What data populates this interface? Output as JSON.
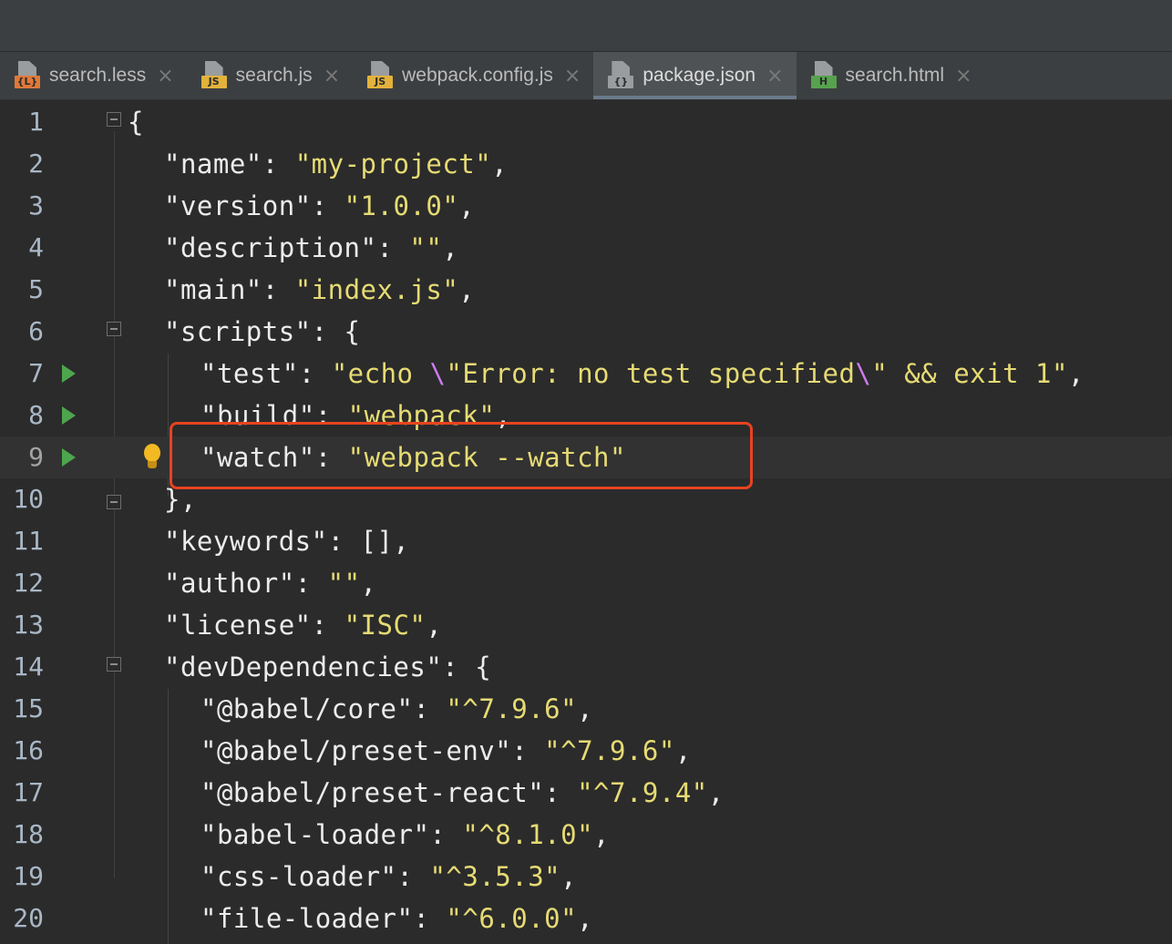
{
  "tabs": [
    {
      "label": "search.less",
      "badge": "{L}",
      "badge_color": "#e0793a",
      "active": false
    },
    {
      "label": "search.js",
      "badge": "JS",
      "badge_color": "#e3b23c",
      "active": false
    },
    {
      "label": "webpack.config.js",
      "badge": "JS",
      "badge_color": "#e3b23c",
      "active": false
    },
    {
      "label": "package.json",
      "badge": "{}",
      "badge_color": "#9a9da0",
      "active": true
    },
    {
      "label": "search.html",
      "badge": "H",
      "badge_color": "#56a24f",
      "active": false
    }
  ],
  "tab_close_glyph": "×",
  "current_line": 9,
  "lines": [
    {
      "n": "1",
      "parts": [
        [
          "k",
          "{"
        ]
      ]
    },
    {
      "n": "2",
      "parts": [
        [
          "k",
          "\"name\": "
        ],
        [
          "s",
          "\"my-project\""
        ],
        [
          "k",
          ","
        ]
      ]
    },
    {
      "n": "3",
      "parts": [
        [
          "k",
          "\"version\": "
        ],
        [
          "s",
          "\"1.0.0\""
        ],
        [
          "k",
          ","
        ]
      ]
    },
    {
      "n": "4",
      "parts": [
        [
          "k",
          "\"description\": "
        ],
        [
          "s",
          "\"\""
        ],
        [
          "k",
          ","
        ]
      ]
    },
    {
      "n": "5",
      "parts": [
        [
          "k",
          "\"main\": "
        ],
        [
          "s",
          "\"index.js\""
        ],
        [
          "k",
          ","
        ]
      ]
    },
    {
      "n": "6",
      "parts": [
        [
          "k",
          "\"scripts\": {"
        ]
      ]
    },
    {
      "n": "7",
      "parts": [
        [
          "k",
          "\"test\": "
        ],
        [
          "s",
          "\"echo "
        ],
        [
          "esc",
          "\\"
        ],
        [
          "s",
          "\"Error: no test specified"
        ],
        [
          "esc",
          "\\"
        ],
        [
          "s",
          "\" && exit 1\""
        ],
        [
          "k",
          ","
        ]
      ]
    },
    {
      "n": "8",
      "parts": [
        [
          "k",
          "\"build\": "
        ],
        [
          "s",
          "\"webpack\""
        ],
        [
          "k",
          ","
        ]
      ]
    },
    {
      "n": "9",
      "parts": [
        [
          "k",
          "\"watch\": "
        ],
        [
          "s",
          "\"webpack --watch\""
        ]
      ]
    },
    {
      "n": "10",
      "parts": [
        [
          "k",
          "},"
        ]
      ]
    },
    {
      "n": "11",
      "parts": [
        [
          "k",
          "\"keywords\": [],"
        ]
      ]
    },
    {
      "n": "12",
      "parts": [
        [
          "k",
          "\"author\": "
        ],
        [
          "s",
          "\"\""
        ],
        [
          "k",
          ","
        ]
      ]
    },
    {
      "n": "13",
      "parts": [
        [
          "k",
          "\"license\": "
        ],
        [
          "s",
          "\"ISC\""
        ],
        [
          "k",
          ","
        ]
      ]
    },
    {
      "n": "14",
      "parts": [
        [
          "k",
          "\"devDependencies\": {"
        ]
      ]
    },
    {
      "n": "15",
      "parts": [
        [
          "k",
          "\"@babel/core\": "
        ],
        [
          "s",
          "\"^7.9.6\""
        ],
        [
          "k",
          ","
        ]
      ]
    },
    {
      "n": "16",
      "parts": [
        [
          "k",
          "\"@babel/preset-env\": "
        ],
        [
          "s",
          "\"^7.9.6\""
        ],
        [
          "k",
          ","
        ]
      ]
    },
    {
      "n": "17",
      "parts": [
        [
          "k",
          "\"@babel/preset-react\": "
        ],
        [
          "s",
          "\"^7.9.4\""
        ],
        [
          "k",
          ","
        ]
      ]
    },
    {
      "n": "18",
      "parts": [
        [
          "k",
          "\"babel-loader\": "
        ],
        [
          "s",
          "\"^8.1.0\""
        ],
        [
          "k",
          ","
        ]
      ]
    },
    {
      "n": "19",
      "parts": [
        [
          "k",
          "\"css-loader\": "
        ],
        [
          "s",
          "\"^3.5.3\""
        ],
        [
          "k",
          ","
        ]
      ]
    },
    {
      "n": "20",
      "parts": [
        [
          "k",
          "\"file-loader\": "
        ],
        [
          "s",
          "\"^6.0.0\""
        ],
        [
          "k",
          ","
        ]
      ]
    }
  ],
  "run_lines": [
    "7",
    "8",
    "9"
  ],
  "colors": {
    "background": "#2b2b2b",
    "string": "#e6db74",
    "key": "#ececec",
    "escape": "#cc7cf0",
    "run_icon": "#4da64d",
    "highlight_box": "#e8431f",
    "intention_bulb": "#f2b922"
  }
}
